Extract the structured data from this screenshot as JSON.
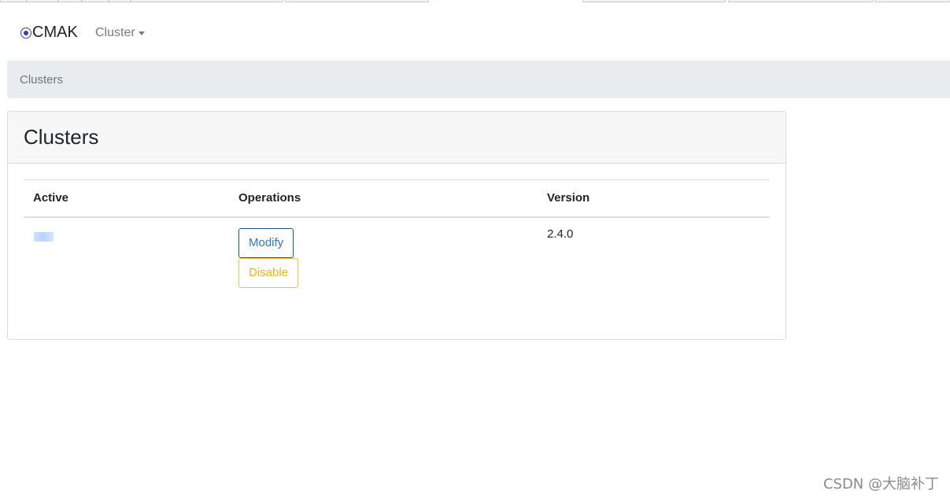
{
  "navbar": {
    "brand": "CMAK",
    "brand_icon": "radio-circle-icon",
    "dropdown_label": "Cluster"
  },
  "breadcrumb": {
    "current": "Clusters"
  },
  "card": {
    "title": "Clusters",
    "table": {
      "headers": [
        "Active",
        "Operations",
        "Version"
      ],
      "rows": [
        {
          "active": "",
          "operations": [
            "Modify",
            "Disable"
          ],
          "version": "2.4.0"
        }
      ]
    }
  },
  "colors": {
    "brand_icon": "#3b3fa6",
    "modify_button": "#2a78c8",
    "disable_button": "#f0b323",
    "breadcrumb_bg": "#e9ecef"
  },
  "watermark": "CSDN @大脑补丁"
}
